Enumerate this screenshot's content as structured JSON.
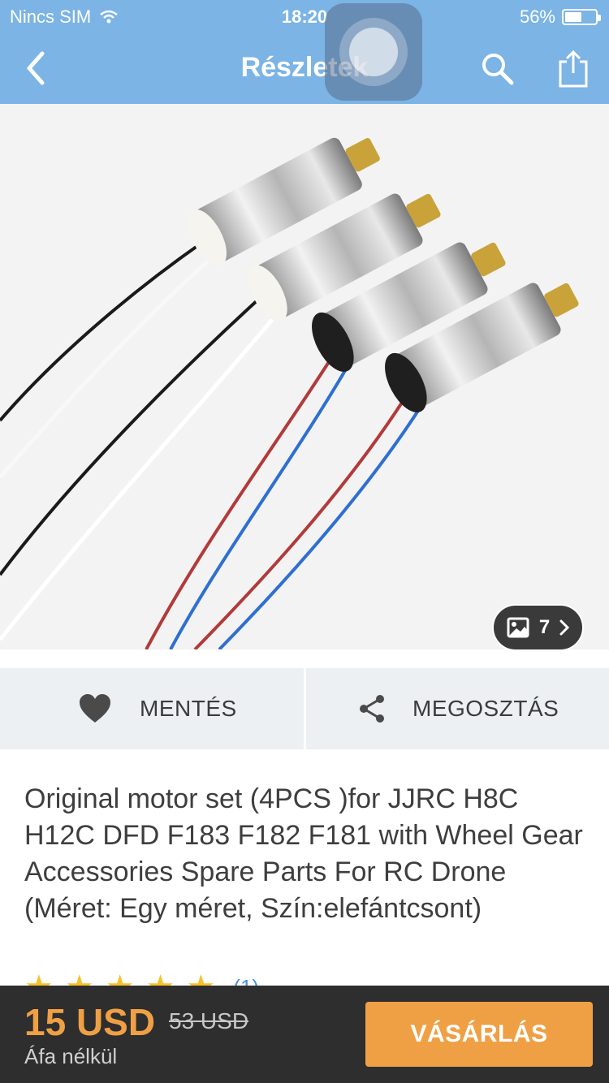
{
  "status_bar": {
    "carrier": "Nincs SIM",
    "time": "18:20",
    "battery_percent": "56%",
    "battery_level": 0.56
  },
  "nav": {
    "title": "Részletek"
  },
  "gallery": {
    "image_count": "7"
  },
  "actions": {
    "save_label": "MENTÉS",
    "share_label": "MEGOSZTÁS"
  },
  "product": {
    "title": "Original motor set (4PCS  )for JJRC H8C H12C DFD F183 F182 F181 with Wheel Gear Accessories Spare Parts For RC Drone (Méret: Egy méret, Szín:elefántcsont)",
    "rating": 5,
    "review_count": "(1)"
  },
  "purchase": {
    "price": "15 USD",
    "old_price": "53 USD",
    "tax_note": "Áfa nélkül",
    "buy_label": "VÁSÁRLÁS"
  },
  "colors": {
    "header": "#7bb4e5",
    "accent": "#f0a044",
    "bottom_bar": "#2e2e2e"
  }
}
